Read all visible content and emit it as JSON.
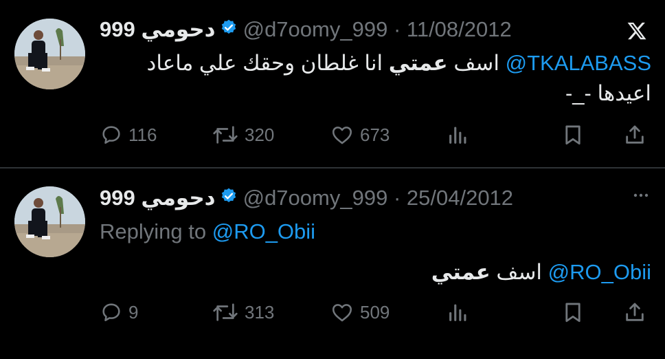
{
  "tweets": [
    {
      "display_name": "دحومي 999",
      "handle": "@d7oomy_999",
      "separator": "·",
      "date": "11/08/2012",
      "mention": "@TKALABASS",
      "text_before": " اسف ",
      "text_bold": "عمتي",
      "text_after": " انا غلطان وحقك علي ماعاد",
      "text_line2": "اعيدها -_-",
      "replies": "116",
      "retweets": "320",
      "likes": "673"
    },
    {
      "display_name": "دحومي 999",
      "handle": "@d7oomy_999",
      "separator": "·",
      "date": "25/04/2012",
      "replying_label": "Replying to",
      "replying_handle": "@RO_Obii",
      "mention": "@RO_Obii",
      "text_before": " اسف ",
      "text_bold": "عمتي",
      "replies": "9",
      "retweets": "313",
      "likes": "509"
    }
  ],
  "icons": {
    "brand": "x-logo-icon",
    "verified": "verified-badge-icon",
    "reply": "reply-icon",
    "retweet": "retweet-icon",
    "like": "like-icon",
    "views": "views-icon",
    "bookmark": "bookmark-icon",
    "share": "share-icon",
    "more": "more-icon"
  },
  "colors": {
    "background": "#000000",
    "text": "#e7e9ea",
    "muted": "#71767b",
    "link": "#1d9bf0",
    "verified": "#1d9bf0",
    "divider": "#2f3336"
  }
}
